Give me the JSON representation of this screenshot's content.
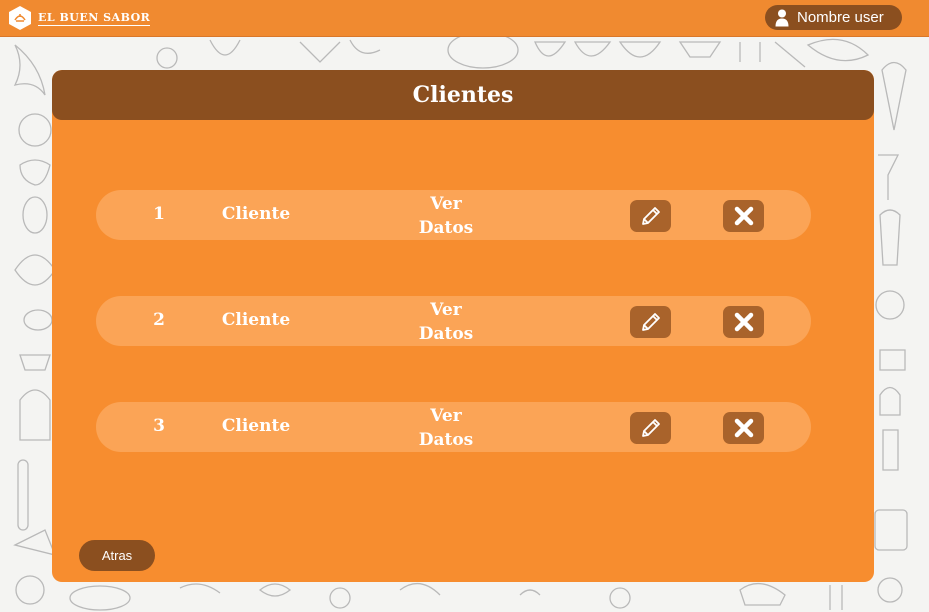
{
  "app": {
    "brand_name": "EL BUEN SABOR",
    "user_name": "Nombre user",
    "colors": {
      "topbar": "#f08a30",
      "panel": "#f78d2f",
      "header": "#8b4f1f",
      "row": "#fba456",
      "icon_button": "#a9632b"
    }
  },
  "page": {
    "title": "Clientes",
    "back_label": "Atras"
  },
  "clients": [
    {
      "number": "1",
      "name": "Cliente",
      "view_line1": "Ver",
      "view_line2": "Datos",
      "edit_icon": "pencil-icon",
      "delete_icon": "close-icon"
    },
    {
      "number": "2",
      "name": "Cliente",
      "view_line1": "Ver",
      "view_line2": "Datos",
      "edit_icon": "pencil-icon",
      "delete_icon": "close-icon"
    },
    {
      "number": "3",
      "name": "Cliente",
      "view_line1": "Ver",
      "view_line2": "Datos",
      "edit_icon": "pencil-icon",
      "delete_icon": "close-icon"
    }
  ]
}
